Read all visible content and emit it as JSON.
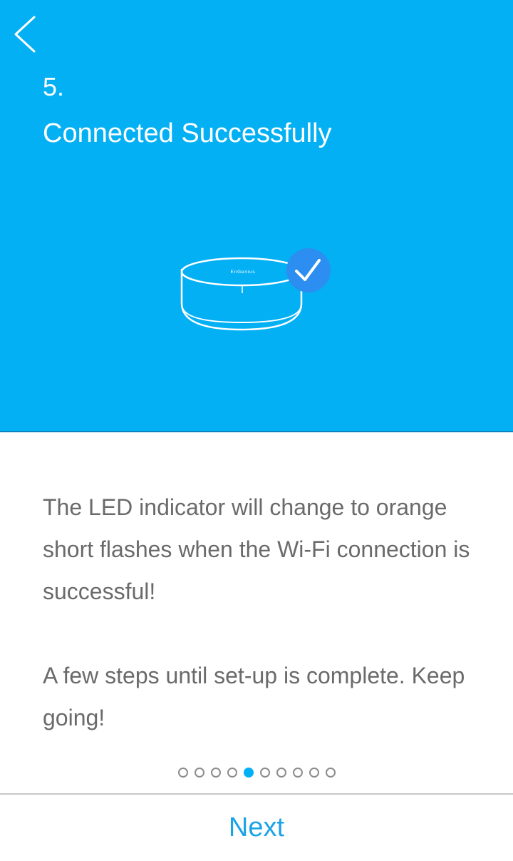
{
  "header": {
    "step_number": "5.",
    "title": "Connected Successfully",
    "back_icon": "chevron-left-icon"
  },
  "illustration": {
    "device_logo_text": "EnGenius",
    "status_icon": "checkmark-icon",
    "badge_color": "#2b8ef0"
  },
  "content": {
    "paragraph_1": "The LED indicator will change to orange short flashes when the Wi-Fi connection is successful!",
    "paragraph_2": "A few steps until set-up is complete. Keep going!"
  },
  "pager": {
    "total": 10,
    "current": 5
  },
  "footer": {
    "next_label": "Next"
  },
  "colors": {
    "accent": "#04b0f4",
    "text": "#6a6a6a",
    "button_text": "#1aa3e6"
  }
}
